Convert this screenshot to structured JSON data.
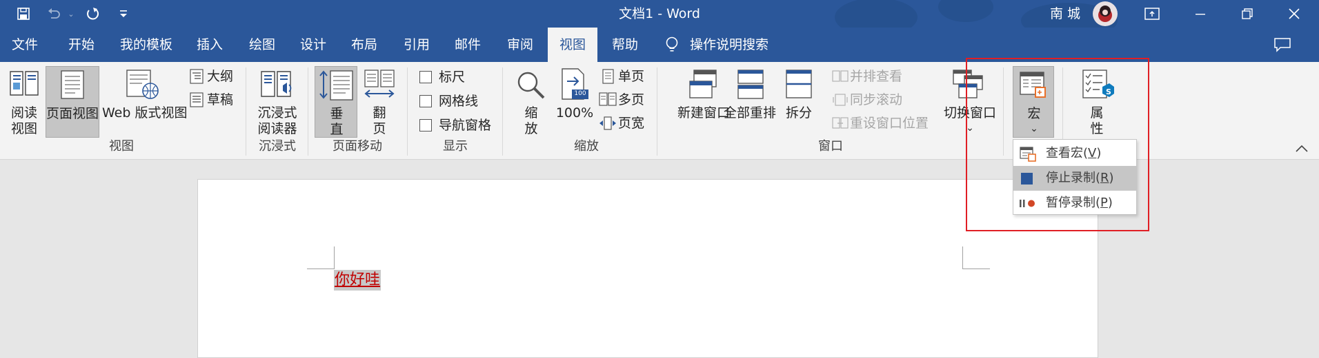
{
  "window": {
    "title": "文档1 - Word",
    "user_name": "南 城",
    "qat": [
      "save-icon",
      "undo-icon",
      "redo-icon",
      "customize-qat-icon"
    ]
  },
  "tabs": [
    {
      "label": "文件"
    },
    {
      "label": "开始"
    },
    {
      "label": "我的模板"
    },
    {
      "label": "插入"
    },
    {
      "label": "绘图"
    },
    {
      "label": "设计"
    },
    {
      "label": "布局"
    },
    {
      "label": "引用"
    },
    {
      "label": "邮件"
    },
    {
      "label": "审阅"
    },
    {
      "label": "视图",
      "active": true
    },
    {
      "label": "帮助"
    }
  ],
  "tell_me": "操作说明搜索",
  "ribbon": {
    "views": {
      "group": "视图",
      "read_mode": [
        "阅读",
        "视图"
      ],
      "print_layout": "页面视图",
      "web_layout": "Web 版式视图",
      "outline": "大纲",
      "draft": "草稿"
    },
    "immersive": {
      "group": "沉浸式",
      "reader": [
        "沉浸式",
        "阅读器"
      ]
    },
    "page_movement": {
      "group": "页面移动",
      "vertical": [
        "垂",
        "直"
      ],
      "side": [
        "翻",
        "页"
      ]
    },
    "show": {
      "group": "显示",
      "ruler": "标尺",
      "gridlines": "网格线",
      "nav_pane": "导航窗格"
    },
    "zoom": {
      "group": "缩放",
      "zoom": [
        "缩",
        "放"
      ],
      "hundred": "100%",
      "hundred_icon_text": "100",
      "one_page": "单页",
      "multi_page": "多页",
      "page_width": "页宽"
    },
    "window": {
      "group": "窗口",
      "new_window": "新建窗口",
      "arrange_all": "全部重排",
      "split": "拆分",
      "side_by_side": "并排查看",
      "sync_scroll": "同步滚动",
      "reset_pos": "重设窗口位置",
      "switch": "切换窗口",
      "switch_arrow": "⌄"
    },
    "macros": {
      "label": "宏",
      "arrow": "⌄"
    },
    "properties": {
      "label": [
        "属",
        "性"
      ]
    }
  },
  "macro_menu": [
    {
      "label": "查看宏",
      "key": "V"
    },
    {
      "label": "停止录制",
      "key": "R",
      "highlighted": true
    },
    {
      "label": "暂停录制",
      "key": "P"
    }
  ],
  "document": {
    "text": "你好哇"
  },
  "colors": {
    "brand": "#2b579a",
    "text_red": "#c00000",
    "highlight_box": "#e01e24"
  }
}
